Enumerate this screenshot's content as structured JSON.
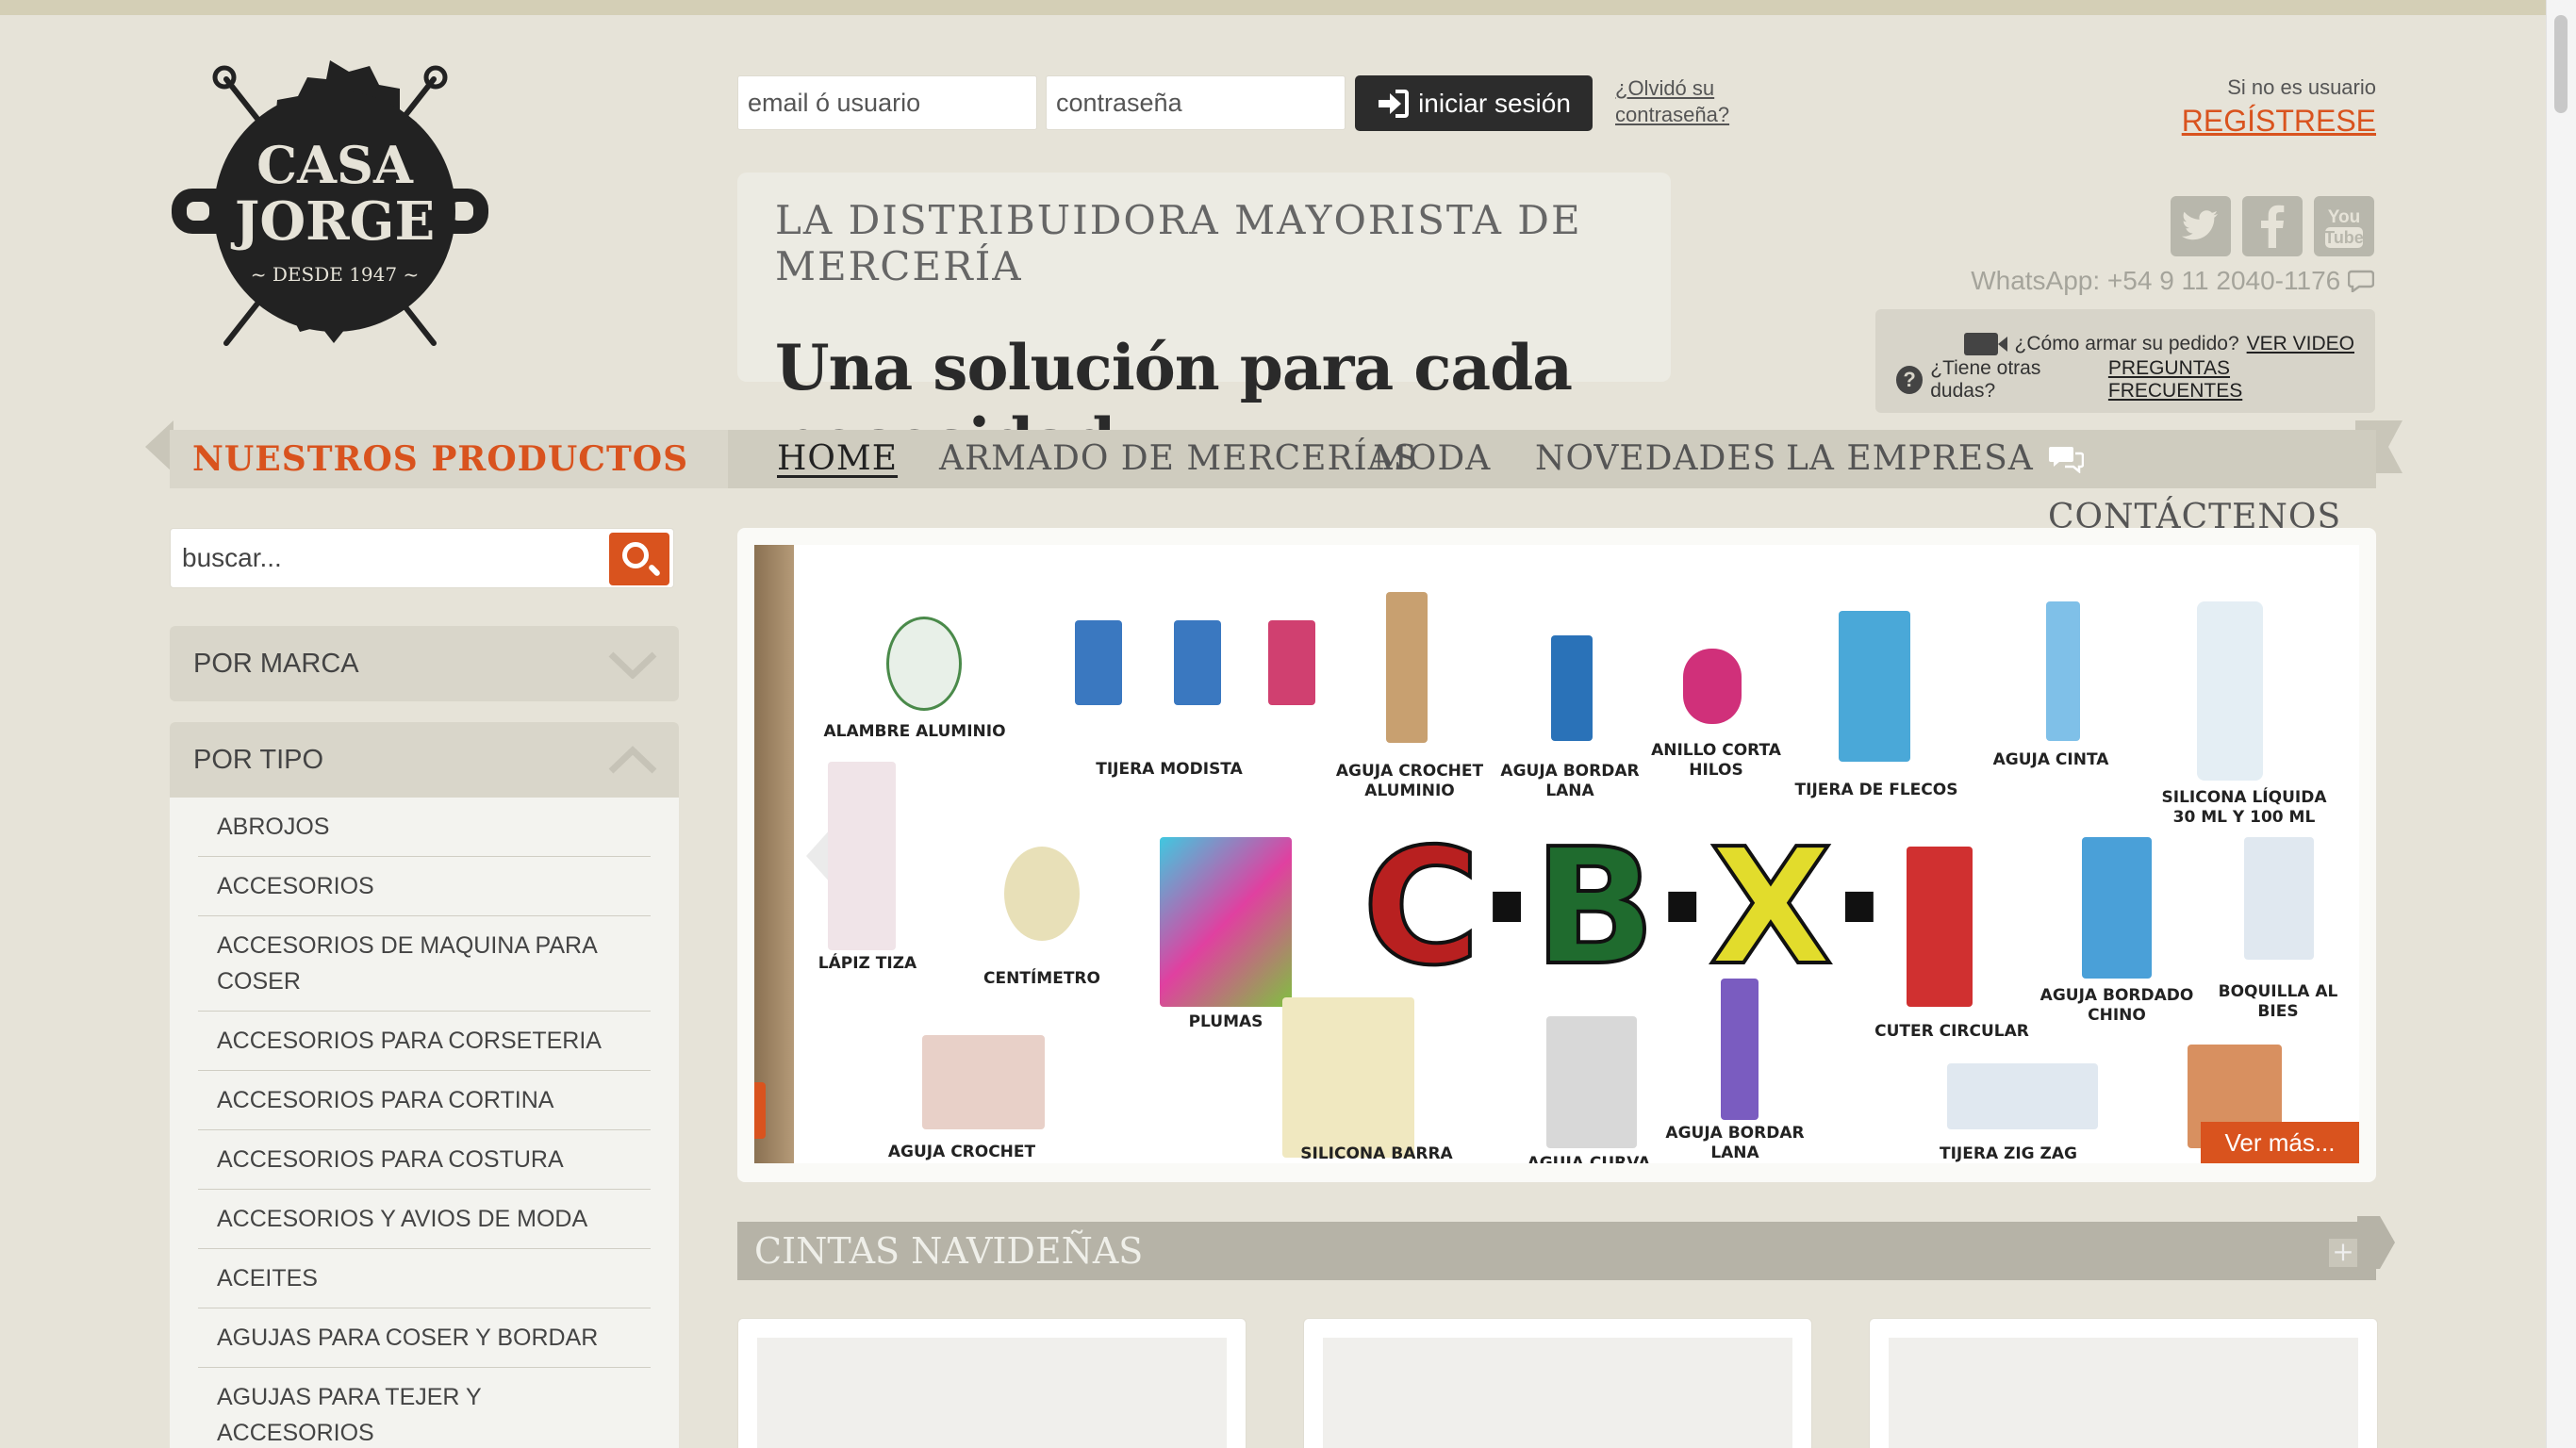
{
  "logo": {
    "line1": "CASA",
    "line2": "JORGE",
    "line3": "~ DESDE 1947 ~"
  },
  "login": {
    "email_placeholder": "email ó usuario",
    "password_placeholder": "contraseña",
    "button_label": "iniciar sesión",
    "forgot_label": "¿Olvidó su contraseña?"
  },
  "register": {
    "prompt": "Si no es usuario",
    "link": "REGÍSTRESE"
  },
  "tagline": {
    "line1": "LA DISTRIBUIDORA MAYORISTA DE MERCERÍA",
    "line2": "Una solución para cada necesidad"
  },
  "social": {
    "icons": [
      "twitter-icon",
      "facebook-icon",
      "youtube-icon"
    ],
    "whatsapp": "WhatsApp: +54 9 11 2040-1176"
  },
  "help": {
    "video_text": "¿Cómo armar su pedido?",
    "video_link": "VER VIDEO",
    "faq_text": "¿Tiene otras dudas?",
    "faq_link": "PREGUNTAS FRECUENTES"
  },
  "nav": {
    "products": "NUESTROS PRODUCTOS",
    "items": [
      "HOME",
      "ARMADO DE MERCERÍAS",
      "MODA",
      "NOVEDADES",
      "LA EMPRESA",
      "CONTÁCTENOS"
    ],
    "active": "HOME"
  },
  "sidebar": {
    "search_placeholder": "buscar...",
    "filter_brand": "POR MARCA",
    "filter_type": "POR TIPO",
    "types": [
      "ABROJOS",
      "ACCESORIOS",
      "ACCESORIOS DE MAQUINA PARA COSER",
      "ACCESORIOS PARA CORSETERIA",
      "ACCESORIOS PARA CORTINA",
      "ACCESORIOS PARA COSTURA",
      "ACCESORIOS Y AVIOS DE MODA",
      "ACEITES",
      "AGUJAS PARA COSER Y BORDAR",
      "AGUJAS PARA TEJER Y ACCESORIOS"
    ]
  },
  "banner": {
    "brand": "C·B·X",
    "more": "Ver más...",
    "products": [
      "ALAMBRE ALUMINIO",
      "TIJERA MODISTA",
      "AGUJA CROCHET ALUMINIO",
      "AGUJA BORDAR LANA",
      "ANILLO CORTA HILOS",
      "TIJERA DE FLECOS",
      "AGUJA CINTA",
      "SILICONA LÍQUIDA 30 ML Y 100 ML",
      "LÁPIZ TIZA",
      "CENTÍMETRO",
      "PLUMAS",
      "CUTER CIRCULAR",
      "AGUJA BORDADO CHINO",
      "BOQUILLA AL BIES",
      "AGUJA CROCHET SILICONA",
      "SILICONA BARRA GOLD",
      "AGUJA CURVA",
      "AGUJA BORDAR LANA",
      "TIJERA ZIG ZAG"
    ]
  },
  "section": {
    "title": "CINTAS NAVIDEÑAS",
    "toggle": "+"
  }
}
